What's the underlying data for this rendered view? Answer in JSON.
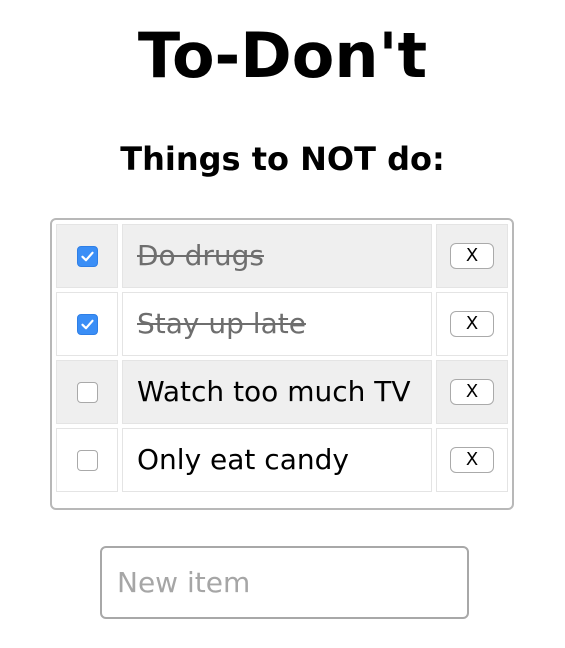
{
  "header": {
    "title": "To-Don't",
    "subtitle": "Things to NOT do:"
  },
  "items": [
    {
      "label": "Do drugs",
      "checked": true,
      "delete_label": "X"
    },
    {
      "label": "Stay up late",
      "checked": true,
      "delete_label": "X"
    },
    {
      "label": "Watch too much TV",
      "checked": false,
      "delete_label": "X"
    },
    {
      "label": "Only eat candy",
      "checked": false,
      "delete_label": "X"
    }
  ],
  "new_item": {
    "placeholder": "New item",
    "value": ""
  },
  "colors": {
    "checkbox_checked": "#3a8ef6",
    "striped_row": "#efefef",
    "done_text": "#6e6e6e"
  },
  "icons": {
    "checkmark": "checkmark-icon"
  }
}
